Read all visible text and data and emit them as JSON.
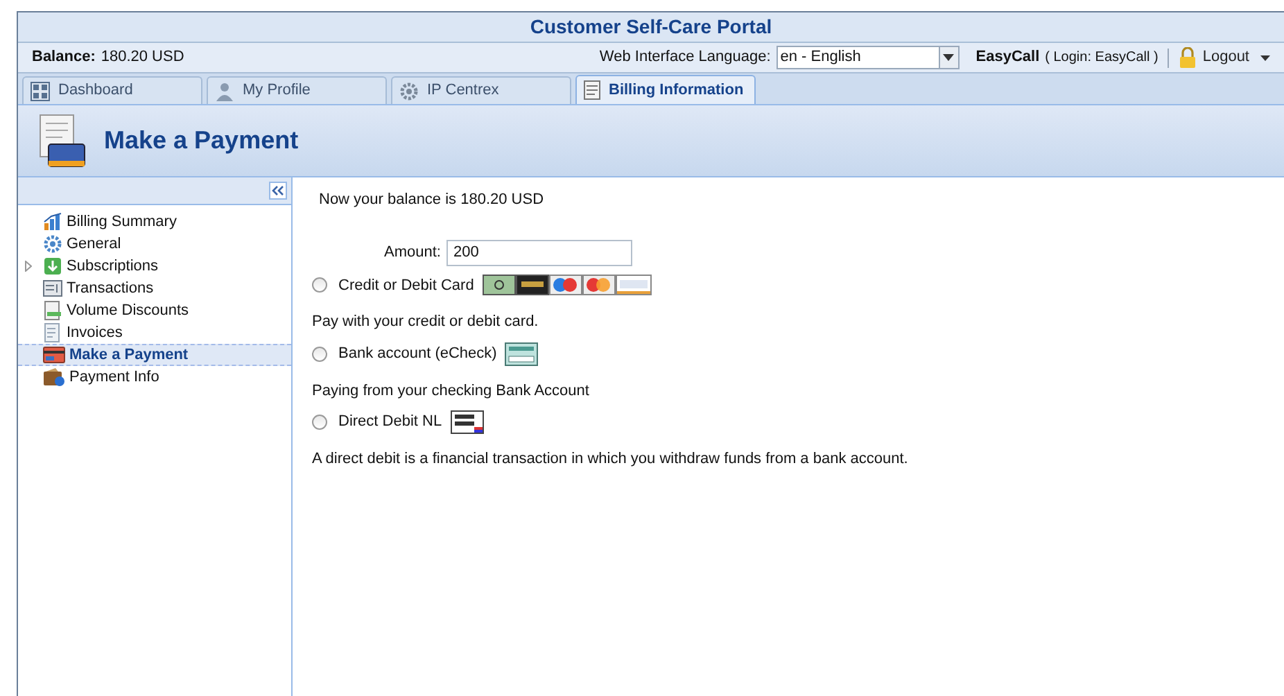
{
  "window": {
    "title": "Customer Self-Care Portal"
  },
  "topbar": {
    "balance_label": "Balance:",
    "balance_value": "180.20 USD",
    "language_label": "Web Interface Language:",
    "language_value": "en - English",
    "account": "EasyCall",
    "login": "( Login: EasyCall )",
    "logout": "Logout"
  },
  "tabs": [
    {
      "label": "Dashboard",
      "kind": "dashboard",
      "selected": false
    },
    {
      "label": "My Profile",
      "kind": "profile",
      "selected": false
    },
    {
      "label": "IP Centrex",
      "kind": "centrex",
      "selected": false
    },
    {
      "label": "Billing Information",
      "kind": "billing",
      "selected": true
    }
  ],
  "page_title": "Make a Payment",
  "sidebar": {
    "items": [
      {
        "label": "Billing Summary",
        "kind": "chart",
        "selected": false
      },
      {
        "label": "General",
        "kind": "gear",
        "selected": false
      },
      {
        "label": "Subscriptions",
        "kind": "subscriptions",
        "selected": false,
        "expanded": false
      },
      {
        "label": "Transactions",
        "kind": "transactions",
        "selected": false
      },
      {
        "label": "Volume Discounts",
        "kind": "discounts",
        "selected": false
      },
      {
        "label": "Invoices",
        "kind": "invoices",
        "selected": false
      },
      {
        "label": "Make a Payment",
        "kind": "payment",
        "selected": true
      },
      {
        "label": "Payment Info",
        "kind": "info",
        "selected": false
      }
    ]
  },
  "content": {
    "balance_text": "Now your balance is 180.20 USD",
    "amount_label": "Amount:",
    "amount_value": "200",
    "methods": [
      {
        "label": "Credit or Debit Card",
        "kind": "card",
        "selected": false,
        "description": "Pay with your credit or debit card."
      },
      {
        "label": "Bank account (eCheck)",
        "kind": "echeck",
        "selected": false,
        "description": "Paying from your checking Bank Account"
      },
      {
        "label": "Direct Debit NL",
        "kind": "directdebit",
        "selected": false,
        "description": "A direct debit is a financial transaction in which you withdraw funds from a bank account."
      }
    ]
  }
}
